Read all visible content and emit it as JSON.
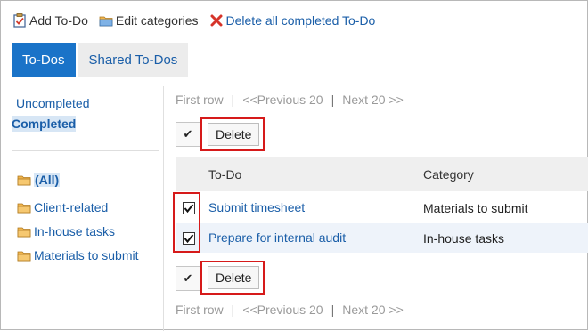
{
  "toolbar": {
    "add_label": "Add To-Do",
    "edit_label": "Edit categories",
    "delete_all_label": "Delete all completed To-Do"
  },
  "tabs": [
    {
      "label": "To-Dos"
    },
    {
      "label": "Shared To-Dos"
    }
  ],
  "sidebar": {
    "status_items": [
      {
        "label": "Uncompleted"
      },
      {
        "label": "Completed"
      }
    ],
    "categories": [
      {
        "label": "(All)"
      },
      {
        "label": "Client-related"
      },
      {
        "label": "In-house tasks"
      },
      {
        "label": "Materials to submit"
      }
    ]
  },
  "pager": {
    "first": "First row",
    "sep": "|",
    "prev": "<<Previous 20",
    "next": "Next 20 >>"
  },
  "actions": {
    "check_all_glyph": "✔",
    "delete_label": "Delete"
  },
  "table": {
    "headers": [
      "To-Do",
      "Category"
    ],
    "rows": [
      {
        "todo": "Submit timesheet",
        "category": "Materials to submit",
        "checked": true
      },
      {
        "todo": "Prepare for internal audit",
        "category": "In-house tasks",
        "checked": true
      }
    ]
  },
  "colors": {
    "accent": "#1a73c8",
    "link": "#1a5ea8",
    "highlight": "#d61a1a",
    "folder": "#f0b44c"
  }
}
